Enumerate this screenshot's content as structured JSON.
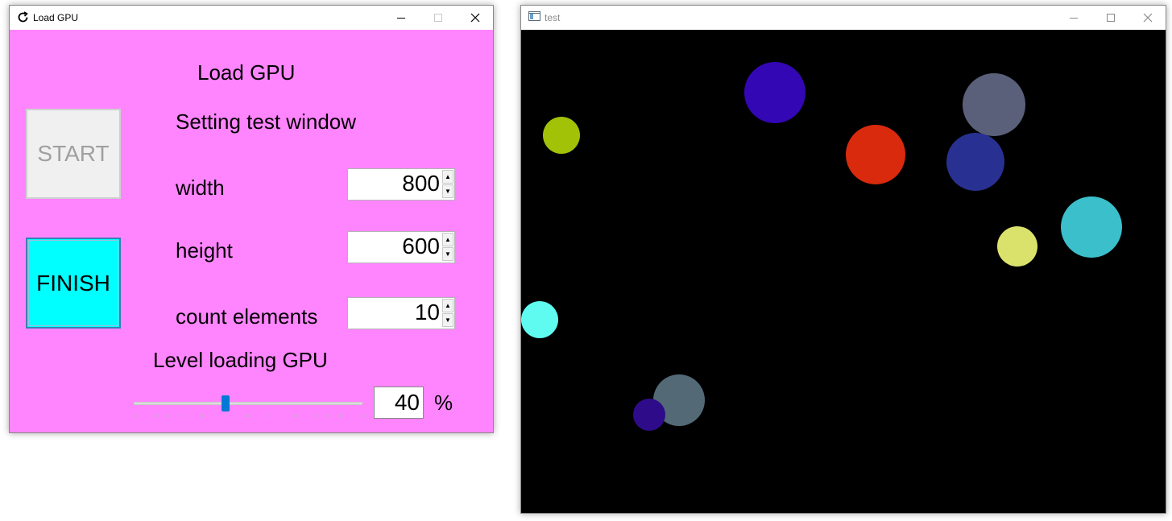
{
  "load_window": {
    "title": "Load GPU",
    "heading": "Load GPU",
    "subheading": "Setting test window",
    "start_label": "START",
    "finish_label": "FINISH",
    "width_label": "width",
    "width_value": "800",
    "height_label": "height",
    "height_value": "600",
    "count_label": "count elements",
    "count_value": "10",
    "level_label": "Level loading GPU",
    "level_value": "40",
    "level_fraction": 0.4,
    "percent_sign": "%",
    "colors": {
      "background": "#ff85ff",
      "finish": "#00ffff",
      "start": "#f0f0f0",
      "slider_thumb": "#0078d7"
    }
  },
  "test_window": {
    "title": "test",
    "background": "#000000",
    "circle_colors": [
      "#3307b4",
      "#5b607a",
      "#a2c208",
      "#d92a0d",
      "#283192",
      "#3abfcb",
      "#dbe26c",
      "#5ffbf0",
      "#536a76",
      "#2e0c89"
    ]
  },
  "window_controls": {
    "minimize": "minimize-icon",
    "maximize": "maximize-icon",
    "close": "close-icon"
  }
}
